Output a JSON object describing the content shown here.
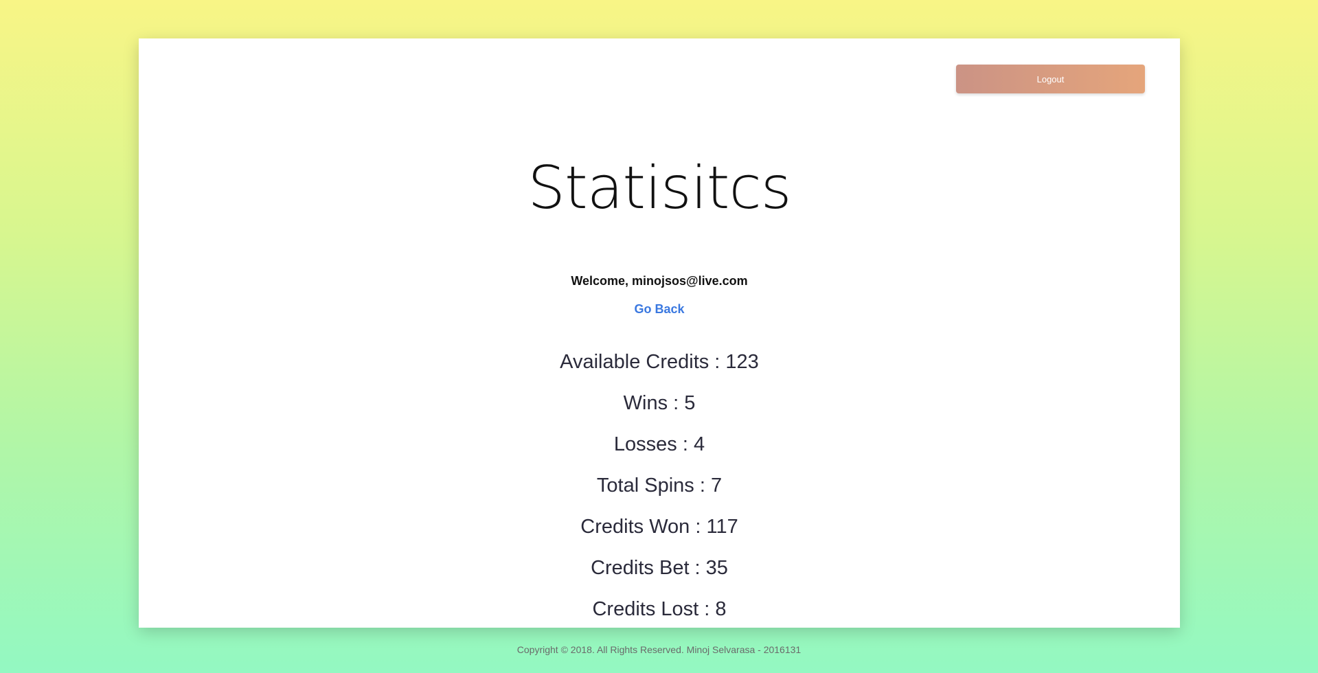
{
  "header": {
    "logout_label": "Logout"
  },
  "page": {
    "title": "Statisitcs",
    "welcome": "Welcome, minojsos@live.com",
    "go_back": "Go Back"
  },
  "stats": [
    "Available Credits : 123",
    "Wins : 5",
    "Losses : 4",
    "Total Spins : 7",
    "Credits Won : 117",
    "Credits Bet : 35",
    "Credits Lost : 8"
  ],
  "footer": {
    "copyright": "Copyright © 2018. All Rights Reserved. Minoj Selvarasa - 2016131"
  },
  "colors": {
    "link": "#3a78e0",
    "logout_gradient_start": "#cb9385",
    "logout_gradient_end": "#e5a57b"
  }
}
